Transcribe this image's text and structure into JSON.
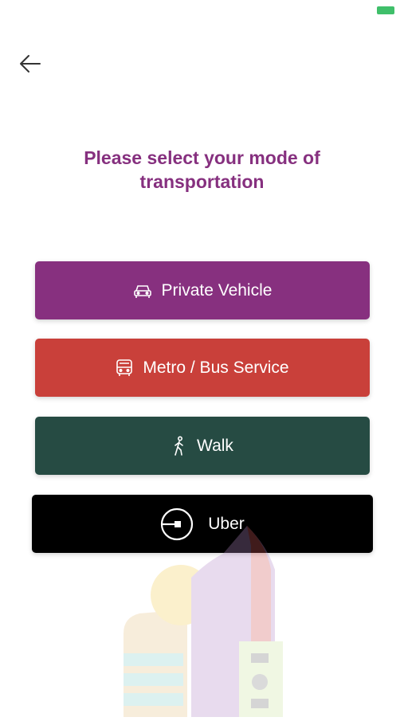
{
  "status_bar": {
    "battery_color": "#3fbf6a"
  },
  "header": {
    "back_icon": "arrow-left-icon"
  },
  "title": "Please select your mode of transportation",
  "options": [
    {
      "label": "Private Vehicle",
      "icon": "car-icon",
      "color": "#87307f"
    },
    {
      "label": "Metro / Bus Service",
      "icon": "bus-icon",
      "color": "#c9403a"
    },
    {
      "label": "Walk",
      "icon": "walking-person-icon",
      "color": "#264b43"
    },
    {
      "label": "Uber",
      "icon": "uber-logo-icon",
      "color": "#000000"
    }
  ]
}
